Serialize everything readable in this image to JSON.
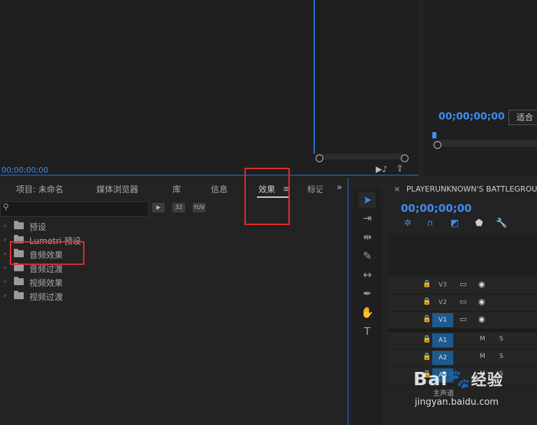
{
  "source_monitor": {
    "timecode": "00;00;00;00"
  },
  "program_monitor": {
    "timecode": "00;00;00;00",
    "fit_label": "适合"
  },
  "effects_panel": {
    "tabs": [
      "项目: 未命名",
      "媒体浏览器",
      "库",
      "信息",
      "效果",
      "标记"
    ],
    "active_tab": "效果",
    "search_placeholder": "",
    "toolbar": [
      "accelerated-effects",
      "32",
      "YUV"
    ],
    "tree": [
      {
        "label": "预设",
        "icon": "preset-folder-icon"
      },
      {
        "label": "Lumetri 预设",
        "icon": "preset-folder-icon"
      },
      {
        "label": "音频效果",
        "icon": "folder-icon"
      },
      {
        "label": "音频过渡",
        "icon": "folder-icon"
      },
      {
        "label": "视频效果",
        "icon": "folder-icon"
      },
      {
        "label": "视频过渡",
        "icon": "folder-icon"
      }
    ]
  },
  "tools": [
    "selection-tool",
    "track-select-tool",
    "ripple-edit-tool",
    "razor-tool",
    "slip-tool",
    "pen-tool",
    "hand-tool",
    "type-tool"
  ],
  "timeline": {
    "sequence_title": "PLAYERUNKNOWN'S BATTLEGROUNDS",
    "timecode": "00;00;00;00",
    "video_tracks": [
      "V3",
      "V2",
      "V1"
    ],
    "audio_tracks": [
      "A1",
      "A2",
      "A3"
    ],
    "mute_label": "M",
    "solo_label": "S",
    "master_label": "主声道"
  },
  "watermark": {
    "logo": "Bai",
    "logo_cn": "经验",
    "url": "jingyan.baidu.com"
  },
  "colors": {
    "accent_blue": "#3f8bf0",
    "highlight_red": "#e02b2b",
    "track_on": "#1e5a8c"
  }
}
